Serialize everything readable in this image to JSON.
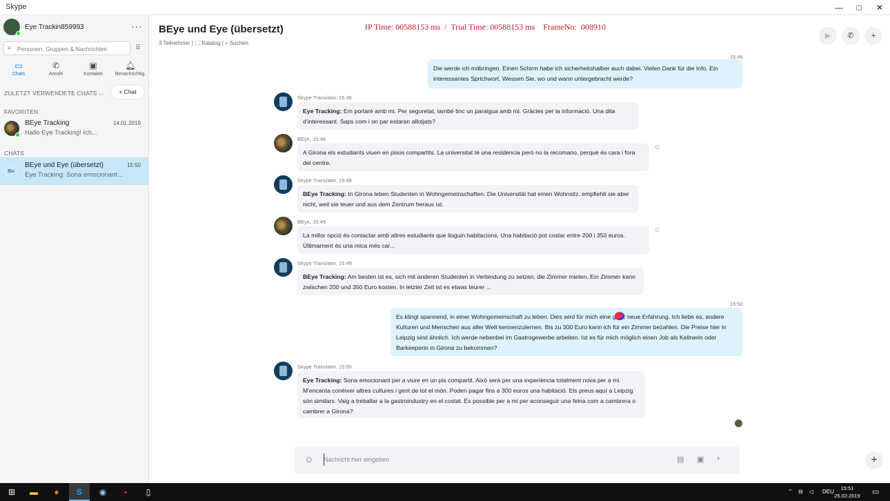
{
  "window": {
    "title": "Skype",
    "minimize": "—",
    "maximize": "□",
    "close": "✕"
  },
  "sidebar": {
    "profile_name": "Eye Trackin859993",
    "more": "···",
    "search_placeholder": "Personen, Gruppen & Nachrichten",
    "tabs": [
      {
        "label": "Chats",
        "icon": "chat-icon"
      },
      {
        "label": "Anrufe",
        "icon": "phone-icon"
      },
      {
        "label": "Kontakte",
        "icon": "contacts-icon"
      },
      {
        "label": "Benachrichtig.",
        "icon": "bell-icon"
      }
    ],
    "recent_label": "ZULETZT VERWENDETE CHATS ⌵",
    "new_chat_label": "+ Chat",
    "favorites_label": "FAVORITEN",
    "chats_label": "CHATS",
    "favorites": [
      {
        "name": "BEye Tracking",
        "preview": "Hallo Eye Tracking! Ich...",
        "time": "14.01.2019"
      }
    ],
    "chats": [
      {
        "name": "BEye und Eye (übersetzt)",
        "preview": "Eye Tracking: Sona emocionant...",
        "time": "15:50",
        "badge": "Bu"
      }
    ]
  },
  "conversation": {
    "title": "BEye und Eye (übersetzt)",
    "subtitle": "3 Teilnehmer | 🗀 Katalog | ⌕ Suchen",
    "overlay": "IP Time: 00588153 ms  /  Trial Time: 00588153 ms    FrameNo:  008910",
    "top_time": "15:46",
    "messages": [
      {
        "dir": "out",
        "text": "Die werde ich mitbringen. Einen Schirm habe ich sicherheitshalber auch dabei. Vielen Dank für die Info. Ein interessantes Sprichwort. Wessen Sie, wo und wann untergebracht werde?"
      },
      {
        "dir": "in",
        "sender": "Skype Translator, 15:46",
        "bold": "Eye Tracking:",
        "text": " Em portaré amb mi. Per seguretat, també tinc un paraigua amb mi. Gràcies per la informació. Una dita d'interessant. Saps com i on par estaran allotjats?"
      },
      {
        "dir": "in",
        "sender": "BEye, 15:48",
        "bold": "",
        "text": "A Girona els estudiants viuen en pisos compartits. La universitat té una residència però no la recomano, perquè és cara i fora del centre."
      },
      {
        "dir": "in",
        "sender": "Skype Translator, 15:48",
        "bold": "BEye Tracking:",
        "text": " In Girona leben Studenten in Wohngemeinschaften. Die Universität hat einen Wohnsitz, empfiehlt sie aber nicht, weil sie teuer und aus dem Zentrum heraus ist."
      },
      {
        "dir": "in",
        "sender": "BEye, 15:49",
        "bold": "",
        "text": "La millor opció és contactar amb altres estudiants que lloguin habitacions. Una habitació pot costar entre 200 i 350 euros. Últimament és una mica més car..."
      },
      {
        "dir": "in",
        "sender": "Skype Translator, 15:49",
        "bold": "BEye Tracking:",
        "text": " Am besten ist es, sich mit anderen Studenten in Verbindung zu setzen, die Zimmer mieten. Ein Zimmer kann zwischen 200 und 350 Euro kosten. In letzter Zeit ist es etwas teurer ..."
      },
      {
        "dir": "out",
        "time": "15:50",
        "text": "Es klingt spannend, in einer Wohngemeinschaft zu leben. Dies wird für mich eine ganz neue Erfahrung. Ich liebe es, andere Kulturen und Menschen aus aller Welt kennenzulernen. Bis zu 300 Euro kann ich für ein Zimmer bezahlen. Die Preise hier in Leipzig sind ähnlich. Ich werde nebenbei im Gastrogewerbe arbeiten. Ist es für mich möglich einen Job als Kellnerin oder Barkeeperin in Girona zu bekommen?"
      },
      {
        "dir": "in",
        "sender": "Skype Translator, 15:50",
        "bold": "Eye Tracking:",
        "text": " Sona emocionant per a viure en un pis compartit. Això serà per una experiència totalment nova per a mi. M'encanta conèixer altres cultures i gent de tot el món. Poden pagar fins a 300 euros una habitació. Els preus aquí a Leipzig són similars. Vaig a treballar a la gastroindustry en el costat. És possible per a mi per aconseguir una feina com a cambrera o cambrer a Girona?"
      }
    ],
    "composer_placeholder": "Nachricht hier eingeben",
    "plus": "+"
  },
  "taskbar": {
    "language": "DEU",
    "time": "15:51",
    "date": "25.02.2019"
  },
  "colors": {
    "accent": "#0078d4",
    "overlay_red": "#c0182b",
    "outgoing_bubble": "#ddf2fb",
    "incoming_bubble": "#f1f3f6",
    "active_chat": "#c6e7f7"
  }
}
